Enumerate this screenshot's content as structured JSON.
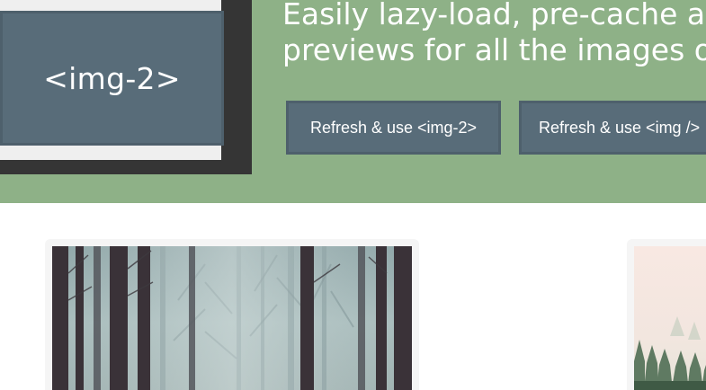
{
  "hero": {
    "preview_label": "<img-2>",
    "headline_line1": "Easily lazy-load, pre-cache and",
    "headline_line2": "previews for all the images on y",
    "buttons": [
      {
        "label": "Refresh & use <img-2>"
      },
      {
        "label": "Refresh & use <img />"
      }
    ],
    "colors": {
      "hero_bg": "#8eb187",
      "button_bg": "#586c79"
    }
  },
  "gallery": {
    "cards": [
      {
        "image": "foggy-forest-photo"
      },
      {
        "image": "misty-pine-treeline-photo"
      }
    ]
  }
}
